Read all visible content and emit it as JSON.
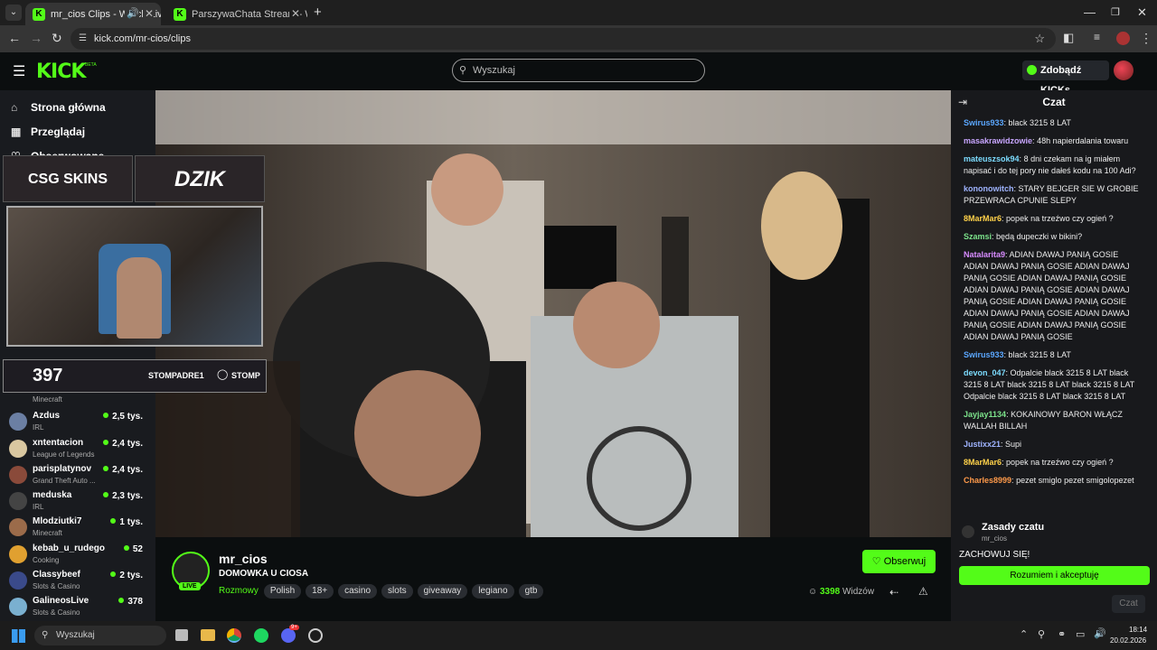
{
  "browser": {
    "tabs": [
      {
        "title": "mr_cios Clips - Watch Live o",
        "active": true
      },
      {
        "title": "ParszywaChata Stream - Watch",
        "active": false
      }
    ],
    "url": "kick.com/mr-cios/clips"
  },
  "header": {
    "logo": "KICK",
    "logo_badge": "BETA",
    "search_placeholder": "Wyszukaj",
    "get_kicks": "Zdobądź KICKs"
  },
  "sidebar": {
    "nav": [
      "Strona główna",
      "Przeglądaj",
      "Obserwowane"
    ],
    "channels": [
      {
        "name": "Azdus",
        "category": "IRL",
        "viewers": "2,5 tys.",
        "color": "#6b7fa3"
      },
      {
        "name": "xntentacion",
        "category": "League of Legends",
        "viewers": "2,4 tys.",
        "color": "#d9c7a0"
      },
      {
        "name": "parisplatynov",
        "category": "Grand Theft Auto ...",
        "viewers": "2,4 tys.",
        "color": "#8a4a3a"
      },
      {
        "name": "meduska",
        "category": "IRL",
        "viewers": "2,3 tys.",
        "color": "#444"
      },
      {
        "name": "Mlodziutki7",
        "category": "Minecraft",
        "viewers": "1 tys.",
        "color": "#9b6b4a"
      },
      {
        "name": "kebab_u_rudego",
        "category": "Cooking",
        "viewers": "52",
        "color": "#e0a030"
      },
      {
        "name": "Classybeef",
        "category": "Slots & Casino",
        "viewers": "2 tys.",
        "color": "#3a4a8a"
      },
      {
        "name": "GalineosLive",
        "category": "Slots & Casino",
        "viewers": "378",
        "color": "#7ab0d0"
      }
    ],
    "partial_category": "Minecraft"
  },
  "overlay": {
    "sponsor1": "CSG SKINS",
    "sponsor2": "DZIK",
    "counter": "397",
    "social1": "STOMPADRE1",
    "social2": "STOMP"
  },
  "stream": {
    "channel": "mr_cios",
    "title": "DOMOWKA U CIOSA",
    "live_badge": "LIVE",
    "category": "Rozmowy",
    "tags": [
      "Polish",
      "18+",
      "casino",
      "slots",
      "giveaway",
      "legiano",
      "gtb"
    ],
    "follow_label": "Obserwuj",
    "viewers": "3398",
    "viewers_label": "Widzów"
  },
  "chat": {
    "title": "Czat",
    "messages": [
      {
        "user": "Swirus933",
        "color": "#5ba7ff",
        "text": "black 3215 8 LAT"
      },
      {
        "user": "masakrawidzowie",
        "color": "#c8a6ff",
        "text": "48h napierdalania towaru"
      },
      {
        "user": "mateuszsok94",
        "color": "#7cdcff",
        "text": "8 dni czekam na ig miałem napisać i do tej pory nie dałeś kodu na 100 Adi?"
      },
      {
        "user": "kononowitch",
        "color": "#9fb4ff",
        "text": "STARY BEJGER SIE W GROBIE PRZEWRACA CPUNIE SLEPY"
      },
      {
        "user": "8MarMar6",
        "color": "#ffd24a",
        "text": "popek na trzeźwo czy ogień ?"
      },
      {
        "user": "Szamsi",
        "color": "#7ce38b",
        "text": "będą dupeczki w bikini?"
      },
      {
        "user": "Natalarita9",
        "color": "#d88cff",
        "text": "ADIAN DAWAJ PANIĄ GOSIE ADIAN DAWAJ PANIĄ GOSIE ADIAN DAWAJ PANIĄ GOSIE ADIAN DAWAJ PANIĄ GOSIE ADIAN DAWAJ PANIĄ GOSIE ADIAN DAWAJ PANIĄ GOSIE ADIAN DAWAJ PANIĄ GOSIE ADIAN DAWAJ PANIĄ GOSIE ADIAN DAWAJ PANIĄ GOSIE ADIAN DAWAJ PANIĄ GOSIE ADIAN DAWAJ PANIĄ GOSIE"
      },
      {
        "user": "Swirus933",
        "color": "#5ba7ff",
        "text": "black 3215 8 LAT"
      },
      {
        "user": "devon_047",
        "color": "#7cdcff",
        "text": "Odpalcie black 3215 8 LAT black 3215 8 LAT black 3215 8 LAT black 3215 8 LAT Odpalcie black 3215 8 LAT black 3215 8 LAT"
      },
      {
        "user": "Jayjay1134",
        "color": "#7ce38b",
        "text": "KOKAINOWY BARON WŁĄCZ WALLAH BILLAH"
      },
      {
        "user": "Justixx21",
        "color": "#9fb4ff",
        "text": "Supi"
      },
      {
        "user": "8MarMar6",
        "color": "#ffd24a",
        "text": "popek na trzeźwo czy ogień ?"
      },
      {
        "user": "Charles8999",
        "color": "#ff9a4a",
        "text": "pezet smiglo pezet smigolopezet"
      }
    ],
    "rules_title": "Zasady czatu",
    "rules_author": "mr_cios",
    "rules_text": "ZACHOWUJ SIĘ!",
    "rules_button": "Rozumiem i akceptuję",
    "send_button": "Czat"
  },
  "taskbar": {
    "search": "Wyszukaj",
    "time": "18:14",
    "date": "20.02.2026",
    "discord_badge": "9+"
  },
  "colors": {
    "accent": "#53fc18",
    "background": "#0b0e0f",
    "panel": "#191b1f"
  }
}
